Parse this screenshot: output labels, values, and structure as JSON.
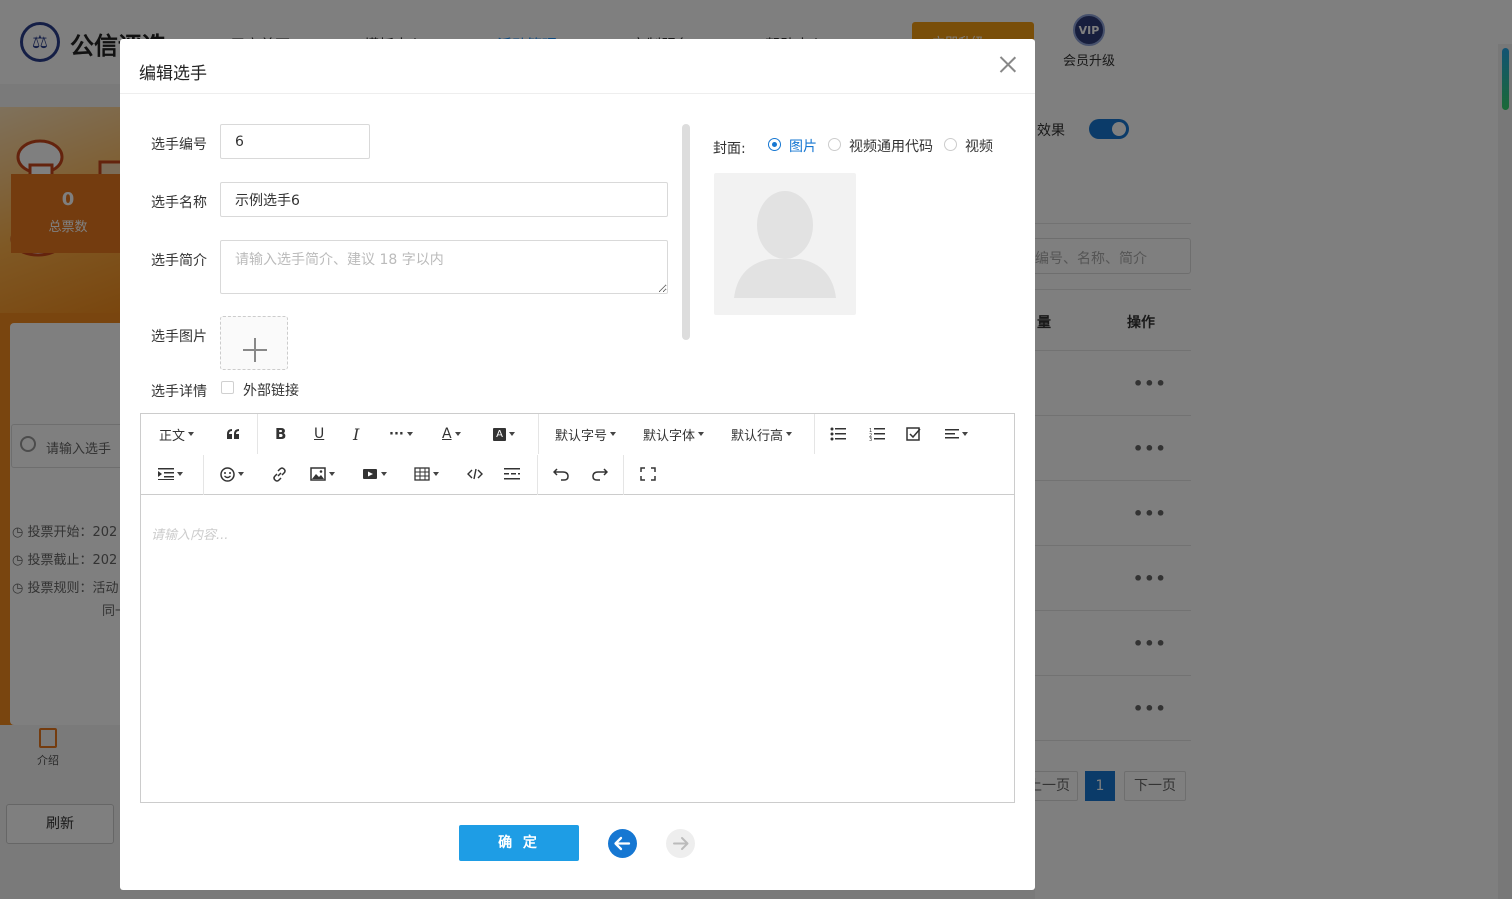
{
  "bg": {
    "brand": "公信评选",
    "logo_glyph": "⚖",
    "nav": [
      "用户首页",
      "模板中心",
      "活动管理",
      "定制服务",
      "帮助中心"
    ],
    "nav_active_index": 2,
    "upgrade_btn": "立即升级",
    "vip_badge": "VIP",
    "vip_label": "会员升级",
    "stat_num": "0",
    "stat_label": "总票数",
    "rule_start": "◷ 投票开始：202",
    "rule_end": "◷ 投票截止：202",
    "rule_rule": "◷ 投票规则：活动",
    "rule_rule2": "同一",
    "search_mini": "请输入选手",
    "intro_tab": "介绍",
    "refresh": "刷新",
    "effect_label": "效果",
    "rp_search_placeholder": "编号、名称、简介",
    "col_qty": "量",
    "col_ops": "操作",
    "row_ops": "•••",
    "prev_page": "上一页",
    "cur_page": "1",
    "next_page": "下一页"
  },
  "modal": {
    "title": "编辑选手",
    "fields": {
      "number_label": "选手编号",
      "number_value": "6",
      "name_label": "选手名称",
      "name_value": "示例选手6",
      "intro_label": "选手简介",
      "intro_placeholder": "请输入选手简介、建议 18 字以内",
      "image_label": "选手图片",
      "detail_label": "选手详情",
      "external_link": "外部链接"
    },
    "cover": {
      "label": "封面:",
      "options": [
        "图片",
        "视频通用代码",
        "视频"
      ],
      "selected_index": 0
    },
    "editor": {
      "toolbar_row1": {
        "paragraph": "正文",
        "font_size": "默认字号",
        "font_family": "默认字体",
        "line_height": "默认行高"
      },
      "placeholder": "请输入内容..."
    },
    "confirm": "确 定"
  }
}
